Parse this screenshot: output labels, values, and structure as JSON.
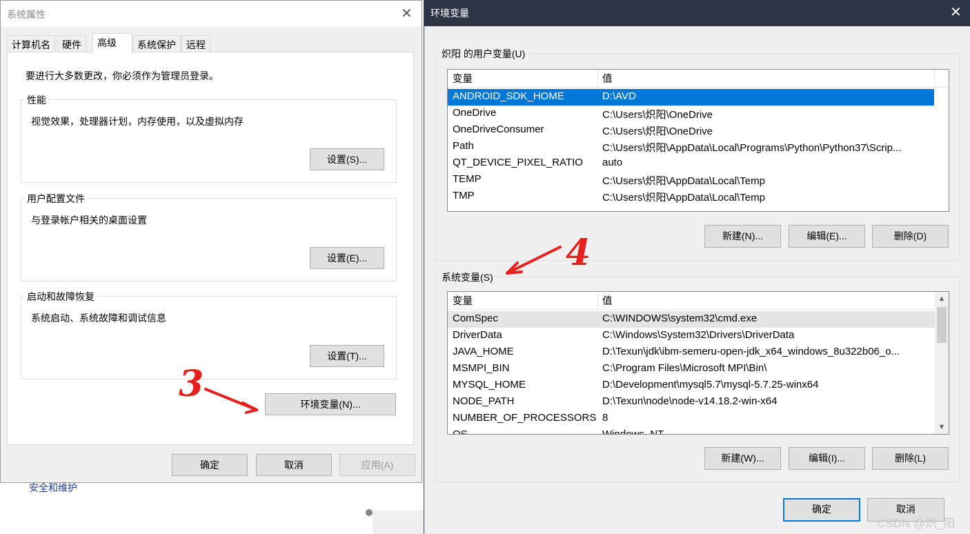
{
  "background": {
    "partial_text": "安全和维护"
  },
  "system_properties": {
    "title": "系统属性",
    "close_glyph": "✕",
    "tabs": [
      {
        "label": "计算机名"
      },
      {
        "label": "硬件"
      },
      {
        "label": "高级"
      },
      {
        "label": "系统保护"
      },
      {
        "label": "远程"
      }
    ],
    "active_tab": "高级",
    "admin_note": "要进行大多数更改，你必须作为管理员登录。",
    "groups": {
      "performance": {
        "legend": "性能",
        "description": "视觉效果，处理器计划，内存使用，以及虚拟内存",
        "button": "设置(S)..."
      },
      "user_profiles": {
        "legend": "用户配置文件",
        "description": "与登录帐户相关的桌面设置",
        "button": "设置(E)..."
      },
      "startup_recovery": {
        "legend": "启动和故障恢复",
        "description": "系统启动、系统故障和调试信息",
        "button": "设置(T)..."
      }
    },
    "env_button": "环境变量(N)...",
    "footer": {
      "ok": "确定",
      "cancel": "取消",
      "apply": "应用(A)"
    }
  },
  "environment_variables": {
    "title": "环境变量",
    "close_glyph": "✕",
    "user_section": {
      "legend": "炽阳 的用户变量(U)",
      "columns": [
        "变量",
        "值"
      ],
      "rows": [
        {
          "name": "ANDROID_SDK_HOME",
          "value": "D:\\AVD",
          "selected": true
        },
        {
          "name": "OneDrive",
          "value": "C:\\Users\\炽阳\\OneDrive"
        },
        {
          "name": "OneDriveConsumer",
          "value": "C:\\Users\\炽阳\\OneDrive"
        },
        {
          "name": "Path",
          "value": "C:\\Users\\炽阳\\AppData\\Local\\Programs\\Python\\Python37\\Scrip..."
        },
        {
          "name": "QT_DEVICE_PIXEL_RATIO",
          "value": "auto"
        },
        {
          "name": "TEMP",
          "value": "C:\\Users\\炽阳\\AppData\\Local\\Temp"
        },
        {
          "name": "TMP",
          "value": "C:\\Users\\炽阳\\AppData\\Local\\Temp"
        }
      ],
      "buttons": {
        "new": "新建(N)...",
        "edit": "编辑(E)...",
        "delete": "删除(D)"
      }
    },
    "system_section": {
      "legend": "系统变量(S)",
      "columns": [
        "变量",
        "值"
      ],
      "rows": [
        {
          "name": "ComSpec",
          "value": "C:\\WINDOWS\\system32\\cmd.exe",
          "hover": true
        },
        {
          "name": "DriverData",
          "value": "C:\\Windows\\System32\\Drivers\\DriverData"
        },
        {
          "name": "JAVA_HOME",
          "value": "D:\\Texun\\jdk\\ibm-semeru-open-jdk_x64_windows_8u322b06_o..."
        },
        {
          "name": "MSMPI_BIN",
          "value": "C:\\Program Files\\Microsoft MPI\\Bin\\"
        },
        {
          "name": "MYSQL_HOME",
          "value": "D:\\Development\\mysql5.7\\mysql-5.7.25-winx64"
        },
        {
          "name": "NODE_PATH",
          "value": "D:\\Texun\\node\\node-v14.18.2-win-x64"
        },
        {
          "name": "NUMBER_OF_PROCESSORS",
          "value": "8"
        },
        {
          "name": "OS",
          "value": "Windows_NT"
        }
      ],
      "scroll_up": "▲",
      "scroll_down": "▼",
      "buttons": {
        "new": "新建(W)...",
        "edit": "编辑(I)...",
        "delete": "删除(L)"
      }
    },
    "footer": {
      "ok": "确定",
      "cancel": "取消"
    }
  },
  "annotations": {
    "step3": "3",
    "step4": "4",
    "color": "#e8201d"
  },
  "watermark": "CSDN @炽_阳",
  "colors": {
    "selection": "#0078d7",
    "env_titlebar": "#2b3544",
    "dialog_bg": "#f0f0f0"
  }
}
